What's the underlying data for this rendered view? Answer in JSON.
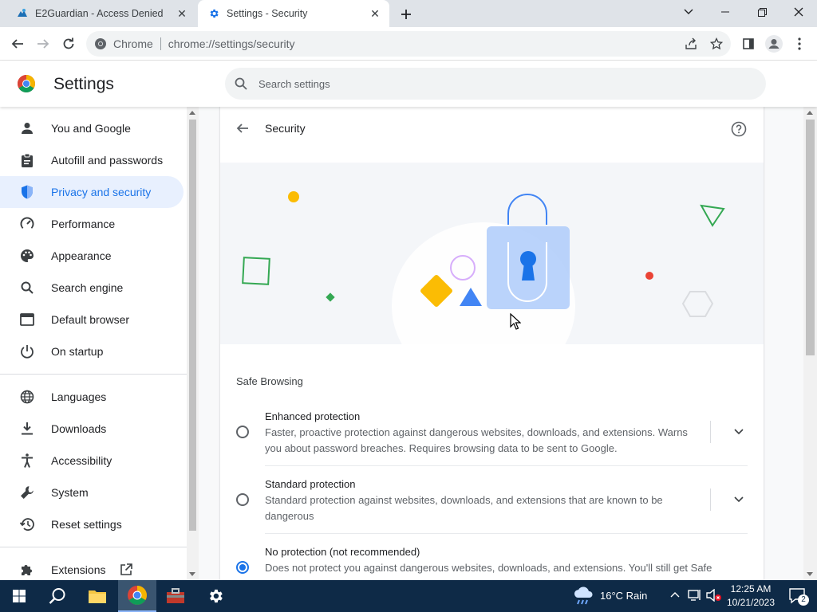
{
  "tabs": [
    {
      "title": "E2Guardian - Access Denied",
      "active": false
    },
    {
      "title": "Settings - Security",
      "active": true
    }
  ],
  "omnibox": {
    "site_label": "Chrome",
    "url": "chrome://settings/security"
  },
  "settings": {
    "title": "Settings",
    "search_placeholder": "Search settings"
  },
  "sidebar": {
    "items": [
      {
        "label": "You and Google",
        "icon": "person-icon"
      },
      {
        "label": "Autofill and passwords",
        "icon": "clipboard-icon"
      },
      {
        "label": "Privacy and security",
        "icon": "shield-icon",
        "selected": true
      },
      {
        "label": "Performance",
        "icon": "speedometer-icon"
      },
      {
        "label": "Appearance",
        "icon": "palette-icon"
      },
      {
        "label": "Search engine",
        "icon": "search-icon"
      },
      {
        "label": "Default browser",
        "icon": "browser-icon"
      },
      {
        "label": "On startup",
        "icon": "power-icon"
      },
      {
        "label": "Languages",
        "icon": "globe-icon"
      },
      {
        "label": "Downloads",
        "icon": "download-icon"
      },
      {
        "label": "Accessibility",
        "icon": "accessibility-icon"
      },
      {
        "label": "System",
        "icon": "wrench-icon"
      },
      {
        "label": "Reset settings",
        "icon": "restore-icon"
      },
      {
        "label": "Extensions",
        "icon": "puzzle-icon"
      }
    ]
  },
  "page": {
    "title": "Security",
    "section_title": "Safe Browsing",
    "options": [
      {
        "label": "Enhanced protection",
        "desc_line1": "Faster, proactive protection against dangerous websites, downloads, and extensions. Warns",
        "desc_line2": "you about password breaches. Requires browsing data to be sent to Google.",
        "checked": false
      },
      {
        "label": "Standard protection",
        "desc_line1": "Standard protection against websites, downloads, and extensions that are known to be",
        "desc_line2": "dangerous",
        "checked": false
      },
      {
        "label": "No protection (not recommended)",
        "desc_line1": "Does not protect you against dangerous websites, downloads, and extensions. You'll still get Safe",
        "checked": true
      }
    ]
  },
  "taskbar": {
    "weather": "16°C  Rain",
    "time": "12:25 AM",
    "date": "10/21/2023",
    "notification_count": "2"
  },
  "colors": {
    "accent": "#1a73e8",
    "selected_bg": "#e8f0fe",
    "tabstrip": "#dfe3e8",
    "taskbar": "#0e2a47"
  }
}
